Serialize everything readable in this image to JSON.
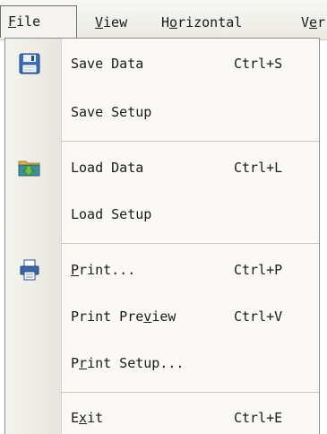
{
  "menubar": {
    "file": {
      "pre": "",
      "accel": "F",
      "post": "ile"
    },
    "view": {
      "pre": "",
      "accel": "V",
      "post": "iew"
    },
    "horizontal": {
      "pre": "H",
      "accel": "o",
      "post": "rizontal"
    },
    "vertical": {
      "pre": "V",
      "accel": "e",
      "post": "r"
    }
  },
  "file_menu": {
    "save_data": {
      "label": "Save Data",
      "shortcut": "Ctrl+S",
      "icon": "save-disk-icon"
    },
    "save_setup": {
      "label": "Save Setup"
    },
    "load_data": {
      "label": "Load Data",
      "shortcut": "Ctrl+L",
      "icon": "load-folder-icon"
    },
    "load_setup": {
      "label": "Load Setup"
    },
    "print": {
      "pre": "",
      "accel": "P",
      "post": "rint...",
      "shortcut": "Ctrl+P",
      "icon": "printer-icon"
    },
    "print_preview": {
      "pre": "Print Pre",
      "accel": "v",
      "post": "iew",
      "shortcut": "Ctrl+V"
    },
    "print_setup": {
      "pre": "P",
      "accel": "r",
      "post": "int Setup...",
      "shortcut": ""
    },
    "exit": {
      "pre": "E",
      "accel": "x",
      "post": "it",
      "shortcut": "Ctrl+E"
    }
  },
  "colors": {
    "menu_background": "#faf9f6",
    "icon_column": "#e6e4dc",
    "separator": "#c9c6bc"
  }
}
